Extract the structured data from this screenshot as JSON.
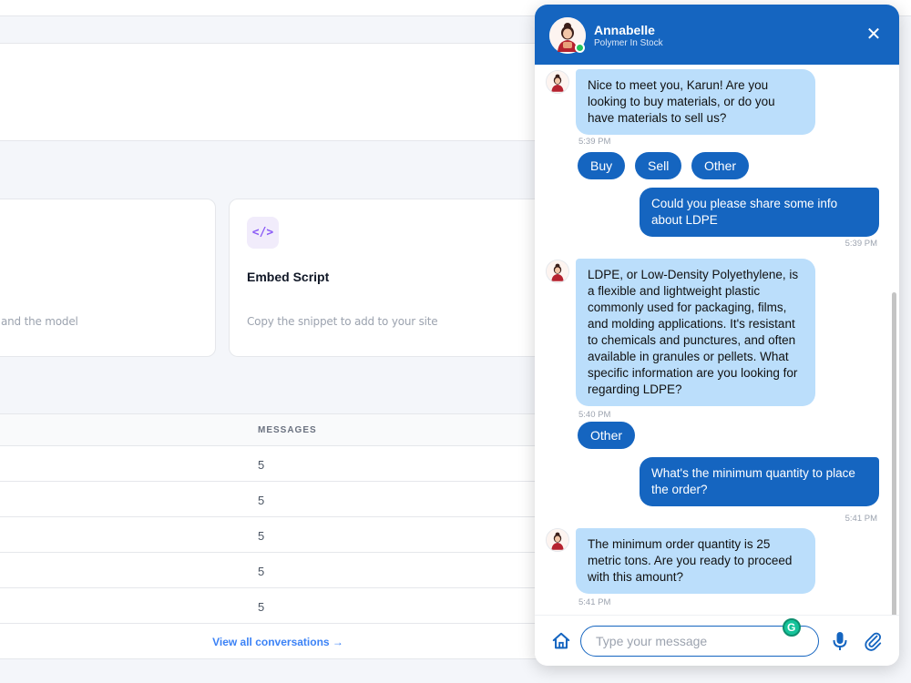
{
  "dashboard": {
    "cards": [
      {
        "title": "",
        "desc": "and the model"
      },
      {
        "icon": "code-icon",
        "icon_glyph": "</>",
        "title": "Embed Script",
        "desc": "Copy the snippet to add to your site"
      }
    ],
    "table": {
      "column_header": "MESSAGES",
      "rows": [
        "5",
        "5",
        "5",
        "5",
        "5"
      ],
      "view_all": "View all conversations →"
    }
  },
  "chat": {
    "agent_name": "Annabelle",
    "agent_subtitle": "Polymer In Stock",
    "close_glyph": "✕",
    "messages": [
      {
        "from": "bot",
        "text": "Nice to meet you, Karun! Are you looking to buy materials, or do you have materials to sell us?",
        "time": "5:39 PM"
      },
      {
        "from": "user",
        "text": "Could you please share some info about LDPE",
        "time": "5:39 PM"
      },
      {
        "from": "bot",
        "text": "LDPE, or Low-Density Polyethylene, is a flexible and lightweight plastic commonly used for packaging, films, and molding applications. It's resistant to chemicals and punctures, and often available in granules or pellets. What specific information are you looking for regarding LDPE?",
        "time": "5:40 PM"
      },
      {
        "from": "user",
        "text": "What's the minimum quantity to place the order?",
        "time": "5:41 PM"
      },
      {
        "from": "bot",
        "text": "The minimum order quantity is 25 metric tons. Are you ready to proceed with this amount?",
        "time": "5:41 PM"
      }
    ],
    "quick_replies_1": [
      "Buy",
      "Sell",
      "Other"
    ],
    "quick_replies_2": [
      "Other"
    ],
    "input_placeholder": "Type your message",
    "grammarly_glyph": "G",
    "colors": {
      "primary": "#1565c0",
      "bot_bubble": "#bbdefb",
      "online": "#22c55e"
    }
  }
}
